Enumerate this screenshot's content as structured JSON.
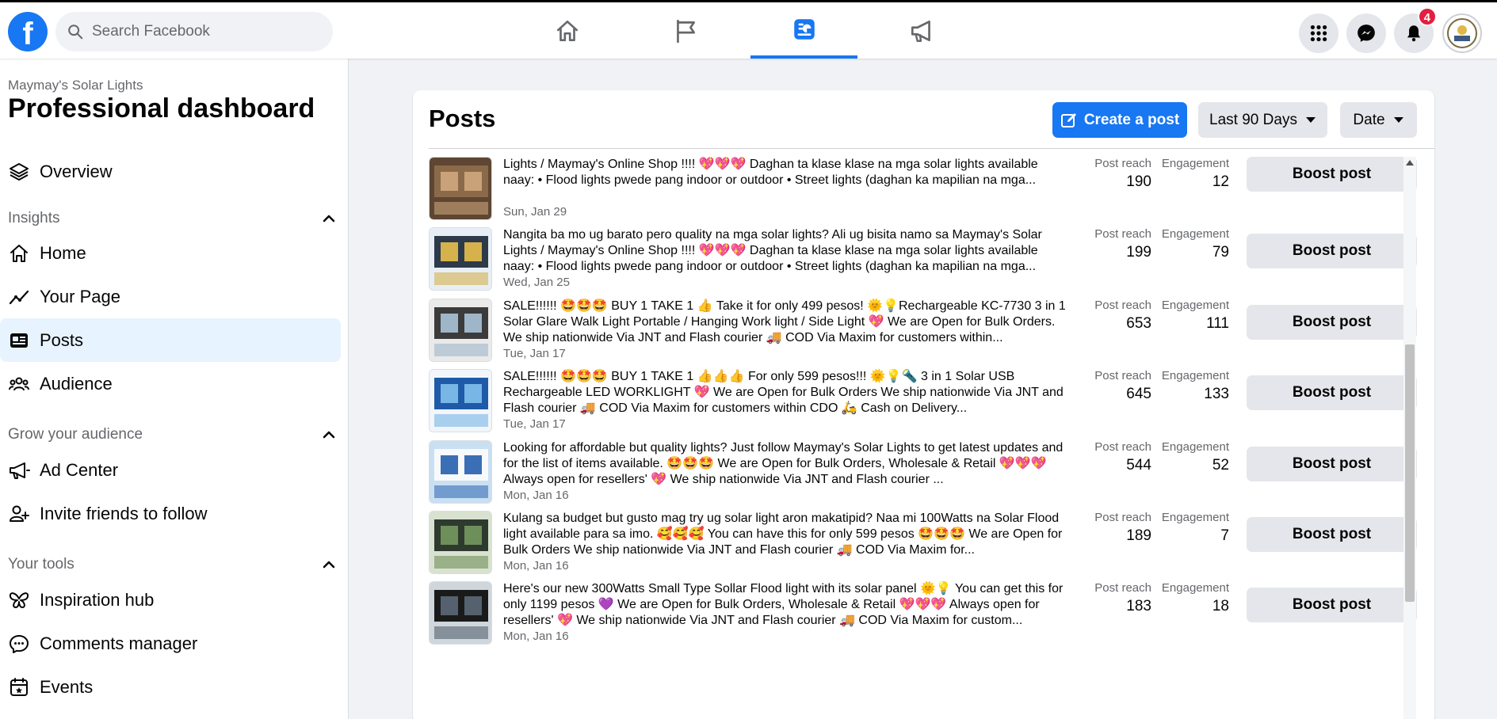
{
  "search": {
    "placeholder": "Search Facebook"
  },
  "nav": {
    "tabs": [
      {
        "icon": "home-icon"
      },
      {
        "icon": "flag-icon"
      },
      {
        "icon": "dashboard-icon",
        "active": true
      },
      {
        "icon": "megaphone-icon"
      }
    ],
    "notifications_count": "4"
  },
  "colors": {
    "brand": "#1877f2",
    "active_bg": "#e7f3ff",
    "badge": "#e41e3f"
  },
  "sidebar": {
    "page_name": "Maymay's Solar Lights",
    "title": "Professional dashboard",
    "overview": "Overview",
    "insights_header": "Insights",
    "insights": [
      "Home",
      "Your Page",
      "Posts",
      "Audience"
    ],
    "grow_header": "Grow your audience",
    "grow": [
      "Ad Center",
      "Invite friends to follow"
    ],
    "tools_header": "Your tools",
    "tools": [
      "Inspiration hub",
      "Comments manager",
      "Events"
    ]
  },
  "posts_panel": {
    "title": "Posts",
    "create_label": "Create a post",
    "range_label": "Last 90 Days",
    "sort_label": "Date",
    "reach_label": "Post reach",
    "engagement_label": "Engagement",
    "boost_label": "Boost post",
    "rows": [
      {
        "text": "Lights / Maymay's Online Shop !!!! 💖💖💖 Daghan ta klase klase na mga solar lights available naay: • Flood lights pwede pang indoor or outdoor • Street lights (daghan ka mapilian na mga...",
        "date": "Sun, Jan 29",
        "reach": "190",
        "engagement": "12"
      },
      {
        "text": "Nangita ba mo ug barato pero quality na mga solar lights? Ali ug bisita namo sa Maymay's Solar Lights / Maymay's Online Shop !!!! 💖💖💖 Daghan ta klase klase na mga solar lights available naay: • Flood lights pwede pang indoor or outdoor • Street lights (daghan ka mapilian na mga...",
        "date": "Wed, Jan 25",
        "reach": "199",
        "engagement": "79"
      },
      {
        "text": "SALE!!!!!! 🤩🤩🤩 BUY 1 TAKE 1 👍 Take it for only 499 pesos! 🌞💡Rechargeable KC-7730 3 in 1 Solar Glare Walk Light Portable / Hanging Work light / Side Light 💖 We are Open for Bulk Orders. We ship nationwide Via JNT and Flash courier 🚚 COD Via Maxim for customers within...",
        "date": "Tue, Jan 17",
        "reach": "653",
        "engagement": "111"
      },
      {
        "text": "SALE!!!!!! 🤩🤩🤩 BUY 1 TAKE 1 👍👍👍 For only 599 pesos!!! 🌞💡🔦 3 in 1 Solar USB Rechargeable LED WORKLIGHT 💖 We are Open for Bulk Orders We ship nationwide Via JNT and Flash courier 🚚 COD Via Maxim for customers within CDO 🛵 Cash on Delivery...",
        "date": "Tue, Jan 17",
        "reach": "645",
        "engagement": "133"
      },
      {
        "text": "Looking for affordable but quality lights? Just follow Maymay's Solar Lights to get latest updates and for the list of items available. 🤩🤩🤩 We are Open for Bulk Orders, Wholesale & Retail 💖💖💖 Always open for resellers' 💖 We ship nationwide Via JNT and Flash courier ...",
        "date": "Mon, Jan 16",
        "reach": "544",
        "engagement": "52"
      },
      {
        "text": "Kulang sa budget but gusto mag try ug solar light aron makatipid? Naa mi 100Watts na Solar Flood light available para sa imo. 🥰🥰🥰 You can have this for only 599 pesos 🤩🤩🤩 We are Open for Bulk Orders We ship nationwide Via JNT and Flash courier 🚚 COD Via Maxim for...",
        "date": "Mon, Jan 16",
        "reach": "189",
        "engagement": "7"
      },
      {
        "text": "Here's our new 300Watts Small Type Sollar Flood light with its solar panel 🌞💡 You can get this for only 1199 pesos 💜 We are Open for Bulk Orders, Wholesale & Retail 💖💖💖 Always open for resellers' 💖 We ship nationwide Via JNT and Flash courier 🚚 COD Via Maxim for custom...",
        "date": "Mon, Jan 16",
        "reach": "183",
        "engagement": "18"
      }
    ]
  }
}
